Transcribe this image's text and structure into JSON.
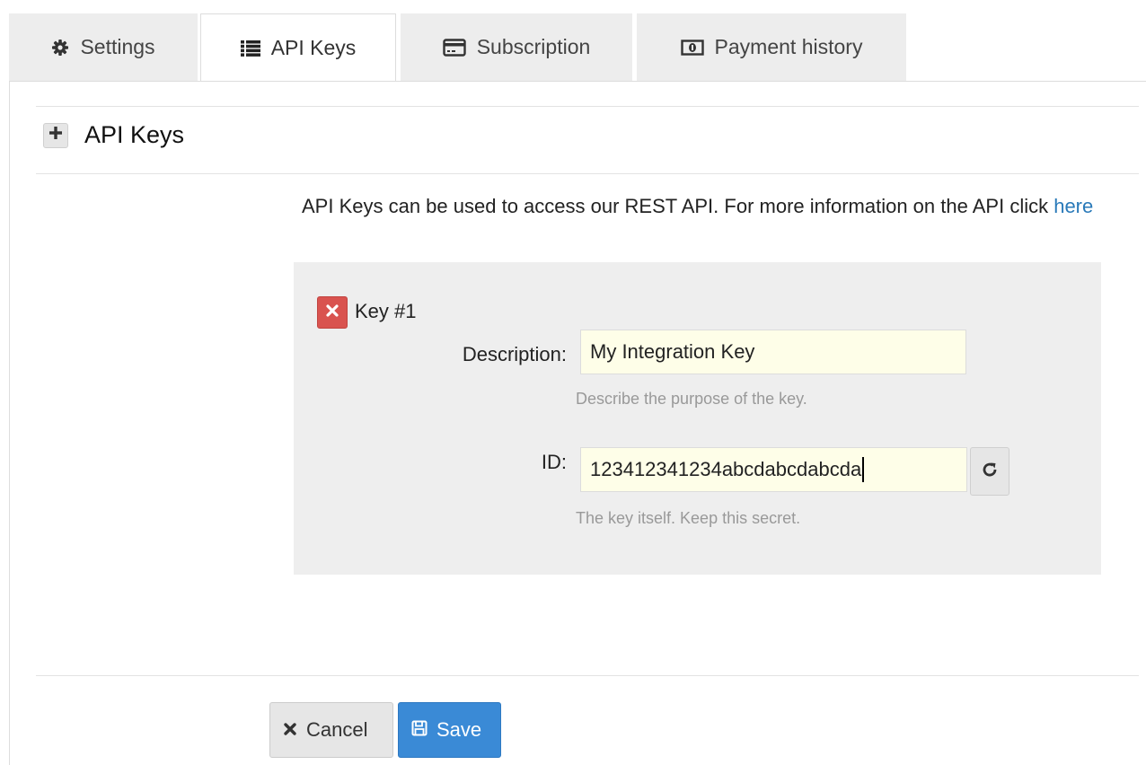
{
  "tabs": [
    {
      "label": "Settings",
      "icon": "gear-icon"
    },
    {
      "label": "API Keys",
      "icon": "list-icon",
      "active": true
    },
    {
      "label": "Subscription",
      "icon": "credit-card-icon"
    },
    {
      "label": "Payment history",
      "icon": "money-bill-icon"
    }
  ],
  "section": {
    "title": "API Keys",
    "add_icon": "plus-icon"
  },
  "intro": {
    "text": "API Keys can be used to access our REST API. For more information on the API click ",
    "link_text": "here"
  },
  "key": {
    "title": "Key #1",
    "delete_icon": "close-icon",
    "description_label": "Description:",
    "description_value": "My Integration Key",
    "description_help": "Describe the purpose of the key.",
    "id_label": "ID:",
    "id_value": "123412341234abcdabcdabcda",
    "id_help": "The key itself. Keep this secret.",
    "refresh_icon": "refresh-icon"
  },
  "actions": {
    "cancel_label": "Cancel",
    "save_label": "Save"
  },
  "colors": {
    "accent": "#3a8ad6",
    "danger": "#d9534f",
    "link": "#2a7ab9",
    "input_bg": "#fefee8"
  }
}
